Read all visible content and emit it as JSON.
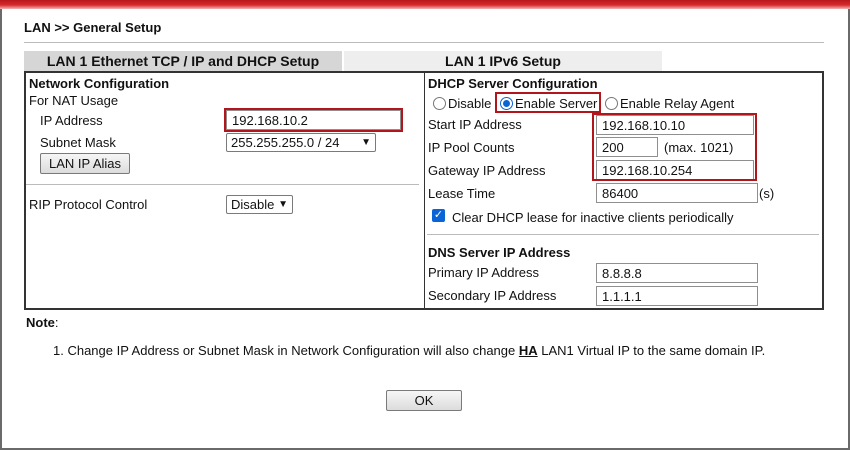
{
  "page": {
    "title": "LAN >> General Setup"
  },
  "tabs": [
    {
      "label": "LAN 1 Ethernet TCP / IP and DHCP Setup",
      "active": true
    },
    {
      "label": "LAN 1 IPv6 Setup",
      "active": false
    }
  ],
  "network": {
    "heading": "Network Configuration",
    "nat_label": "For NAT Usage",
    "ip_label": "IP Address",
    "ip_value": "192.168.10.2",
    "mask_label": "Subnet Mask",
    "mask_value": "255.255.255.0 / 24",
    "alias_button": "LAN IP Alias",
    "rip_label": "RIP Protocol Control",
    "rip_value": "Disable"
  },
  "dhcp": {
    "heading": "DHCP Server Configuration",
    "mode_options": [
      "Disable",
      "Enable Server",
      "Enable Relay Agent"
    ],
    "mode_selected": "Enable Server",
    "start_ip_label": "Start IP Address",
    "start_ip_value": "192.168.10.10",
    "pool_label": "IP Pool Counts",
    "pool_value": "200",
    "pool_max": "(max. 1021)",
    "gateway_label": "Gateway IP Address",
    "gateway_value": "192.168.10.254",
    "lease_label": "Lease Time",
    "lease_value": "86400",
    "lease_unit": "(s)",
    "clear_lease_label": "Clear DHCP lease for inactive clients periodically",
    "clear_lease_checked": true
  },
  "dns": {
    "heading": "DNS Server IP Address",
    "primary_label": "Primary IP Address",
    "primary_value": "8.8.8.8",
    "secondary_label": "Secondary IP Address",
    "secondary_value": "1.1.1.1"
  },
  "note": {
    "label": "Note",
    "text_before": "1. Change IP Address or Subnet Mask in Network Configuration will also change ",
    "text_emphasis": "HA",
    "text_after": " LAN1 Virtual IP to the same domain IP."
  },
  "ok_button": "OK",
  "colors": {
    "accent": "#b0161b",
    "radio": "#0a64d6",
    "topbar": "#c41e22"
  }
}
